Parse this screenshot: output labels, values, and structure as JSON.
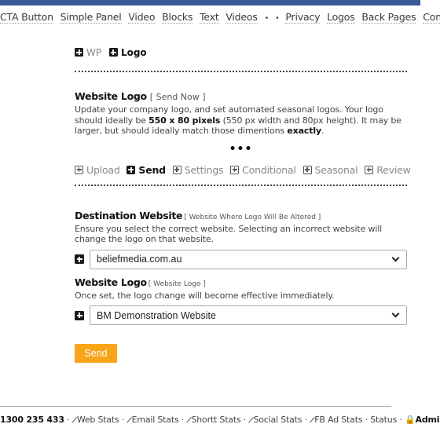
{
  "nav": {
    "items_left": [
      "CTA Button",
      "Simple Panel",
      "Video",
      "Blocks",
      "Text",
      "Videos"
    ],
    "separators": [
      "•",
      "•"
    ],
    "items_right": [
      "Privacy",
      "Logos",
      "Back Pages",
      "Compliance"
    ]
  },
  "crumbs": {
    "wp": "WP",
    "logo": "Logo"
  },
  "intro": {
    "title": "Website Logo",
    "bracket": "[ Send Now ]",
    "text_1": "Update your company logo, and set automated seasonal logos. Your logo should ideally be ",
    "bold_1": "550 x 80 pixels",
    "text_2": " (550 px width and 80px height). It may be larger, but should ideally match those dimentions ",
    "bold_2": "exactly",
    "text_3": "."
  },
  "ellipsis": "•••",
  "tabs": [
    {
      "label": "Upload",
      "active": false
    },
    {
      "label": "Send",
      "active": true
    },
    {
      "label": "Settings",
      "active": false
    },
    {
      "label": "Conditional",
      "active": false
    },
    {
      "label": "Seasonal",
      "active": false
    },
    {
      "label": "Review",
      "active": false
    }
  ],
  "destination": {
    "title": "Destination Website",
    "bracket": "[ Website Where Logo Will Be Altered ]",
    "description": "Ensure you select the correct website. Selecting an incorrect website will change the logo on that website.",
    "selected": "beliefmedia.com.au"
  },
  "website_logo": {
    "title": "Website Logo",
    "bracket": "[ Website Logo ]",
    "description": "Once set, the logo change will become effective immediately.",
    "selected": "BM Demonstration Website"
  },
  "send_button": "Send",
  "footer": {
    "phone": "1300 235 433",
    "links": [
      "Web Stats",
      "Email Stats",
      "Shortt Stats",
      "Social Stats",
      "FB Ad Stats"
    ],
    "status": "Status",
    "admin": "Admin",
    "sep": "·"
  },
  "colors": {
    "topbar": "#3b5998",
    "send_button": "#f8a51b"
  }
}
